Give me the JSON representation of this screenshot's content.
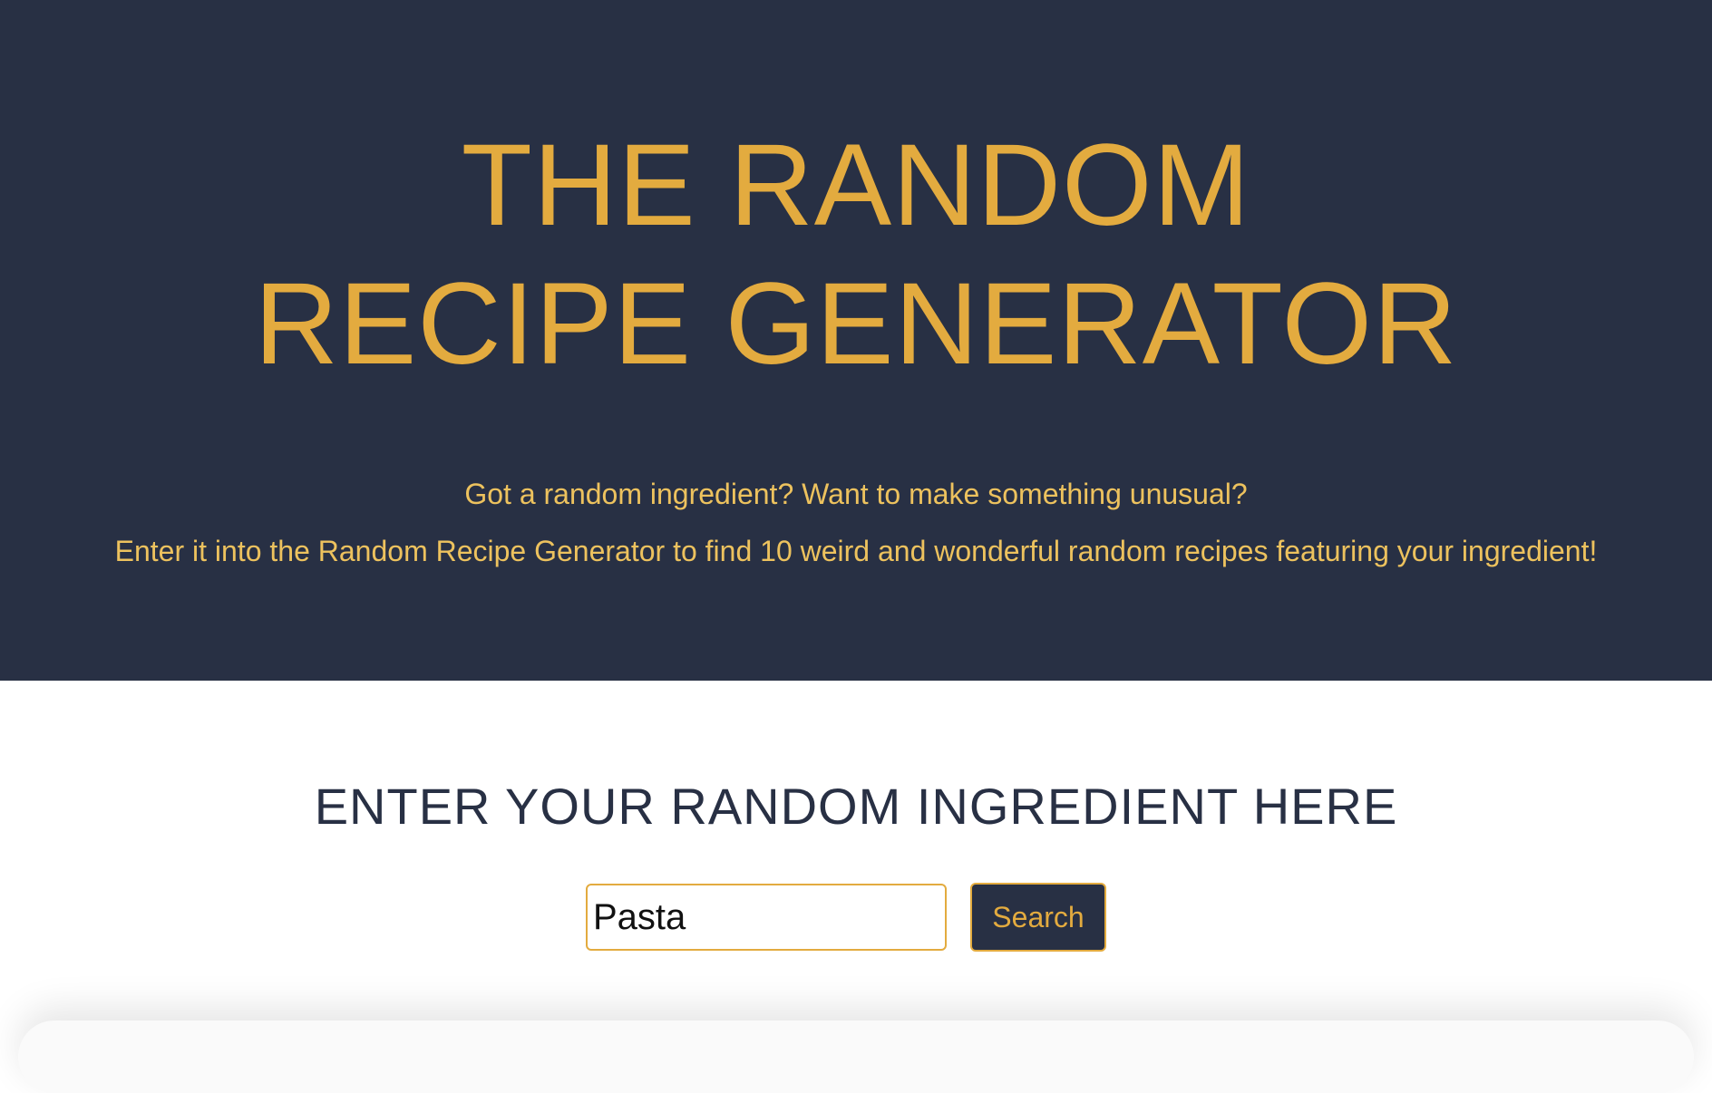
{
  "hero": {
    "title_line1": "THE RANDOM",
    "title_line2": "RECIPE GENERATOR",
    "subtitle_line1": "Got a random ingredient? Want to make something unusual?",
    "subtitle_line2": "Enter it into the Random Recipe Generator to find 10 weird and wonderful random recipes featuring your ingredient!"
  },
  "search": {
    "heading": "ENTER YOUR RANDOM INGREDIENT HERE",
    "input_value": "Pasta",
    "button_label": "Search"
  },
  "colors": {
    "background_dark": "#283044",
    "accent_gold": "#E3AB3F",
    "text_gold_light": "#EDC25E",
    "white": "#FFFFFF"
  }
}
